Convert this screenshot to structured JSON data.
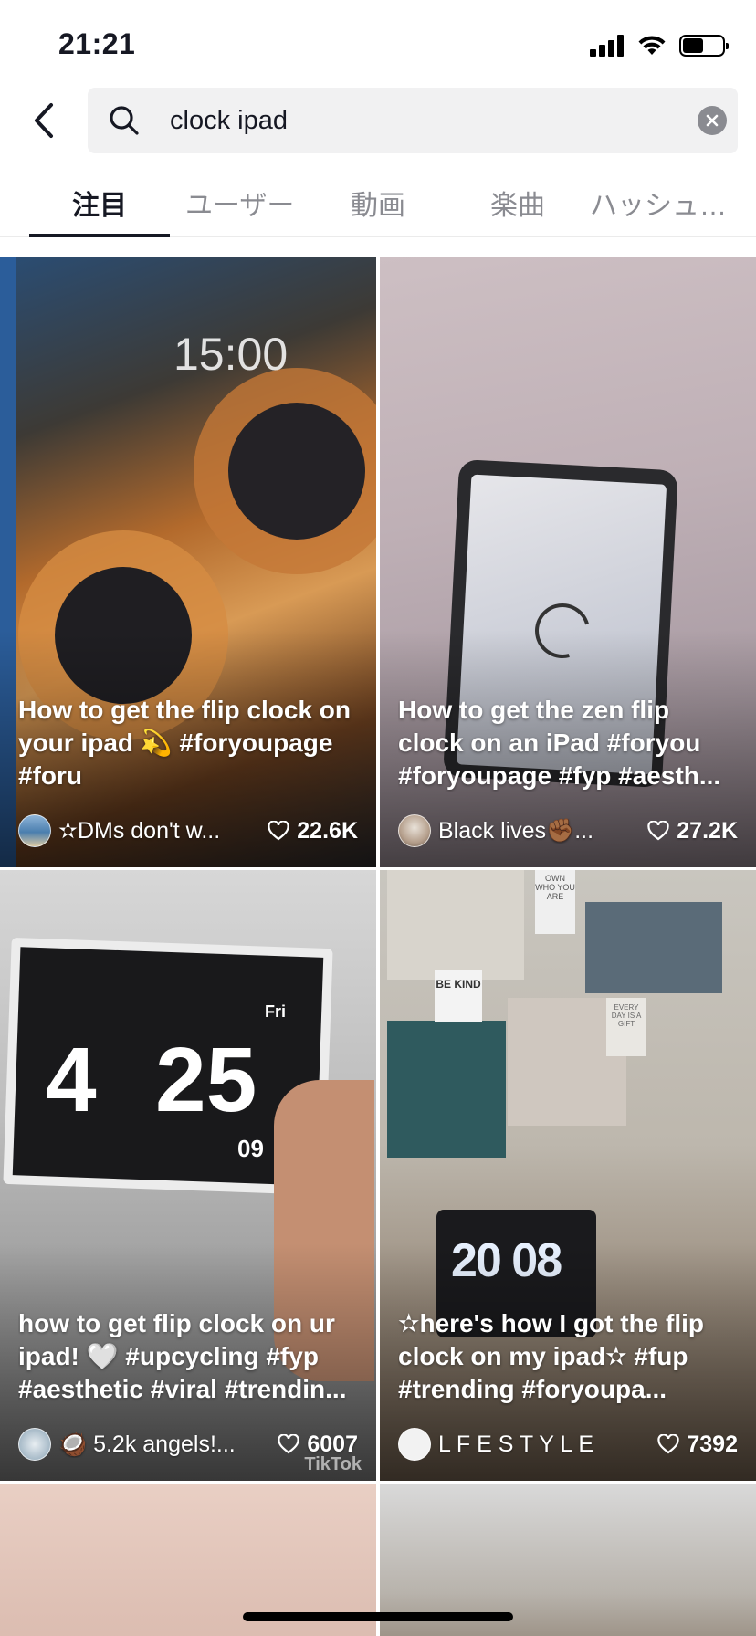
{
  "status_bar": {
    "time": "21:21"
  },
  "search": {
    "query": "clock ipad"
  },
  "tabs": [
    {
      "label": "注目",
      "active": true
    },
    {
      "label": "ユーザー",
      "active": false
    },
    {
      "label": "動画",
      "active": false
    },
    {
      "label": "楽曲",
      "active": false
    },
    {
      "label": "ハッシュ…",
      "active": false
    }
  ],
  "videos": [
    {
      "caption": "How to get the flip clock on your ipad 💫 #foryoupage #foru",
      "author": "✫DMs don't w...",
      "likes": "22.6K",
      "thumb_text": "15:00"
    },
    {
      "caption": "How to get the zen flip clock on an iPad #foryou #foryoupage #fyp #aesth...",
      "author": "Black lives✊🏾...",
      "likes": "27.2K"
    },
    {
      "caption": "how to get flip clock on ur ipad! 🤍 #upcycling #fyp #aesthetic #viral #trendin...",
      "author": "🥥 5.2k angels!...",
      "likes": "6007",
      "thumb_day": "Fri",
      "thumb_hour": "4",
      "thumb_minute": "25",
      "thumb_seconds": "09",
      "watermark": "TikTok"
    },
    {
      "caption": "✫here's how I got the flip clock on my ipad✫ #fup #trending #foryoupa...",
      "author": "L F E S T Y L E",
      "likes": "7392",
      "thumb_text": "20 08",
      "sign_text": "OWN WHO YOU ARE",
      "be_kind": "BE KIND",
      "every_day_text": "EVERY DAY IS A GIFT"
    }
  ],
  "colors": {
    "text_primary": "#161823",
    "text_secondary": "#8a8b91",
    "search_bg": "#f1f1f2"
  }
}
